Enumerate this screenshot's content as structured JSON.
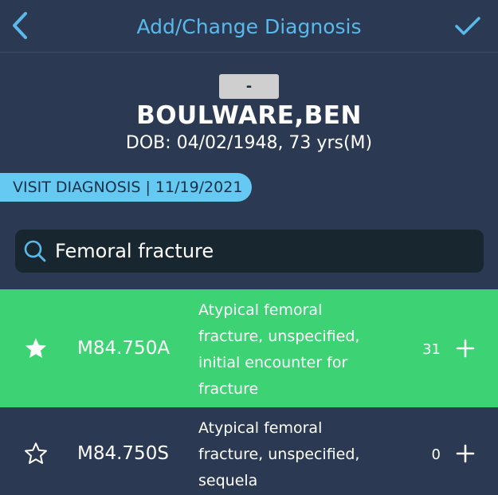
{
  "header": {
    "title": "Add/Change Diagnosis",
    "back_icon": "chevron-left-icon",
    "done_icon": "checkmark-icon",
    "accent": "#5ab8ea"
  },
  "patient": {
    "badge": "-",
    "name": "BOULWARE,BEN",
    "dob_line": "DOB: 04/02/1948, 73 yrs(M)"
  },
  "visit": {
    "label": "VISIT DIAGNOSIS | 11/19/2021",
    "color": "#66c9f2"
  },
  "search": {
    "value": "Femoral fracture",
    "icon": "search-icon"
  },
  "results": [
    {
      "code": "M84.750A",
      "description": "Atypical femoral fracture, unspecified, initial encounter for fracture",
      "count": "31",
      "favorite": true,
      "selected": true,
      "highlight": "#3dd374"
    },
    {
      "code": "M84.750S",
      "description": "Atypical femoral fracture, unspecified, sequela",
      "count": "0",
      "favorite": false,
      "selected": false
    }
  ],
  "colors": {
    "background": "#2b3a52",
    "search_bg": "#18262f"
  }
}
